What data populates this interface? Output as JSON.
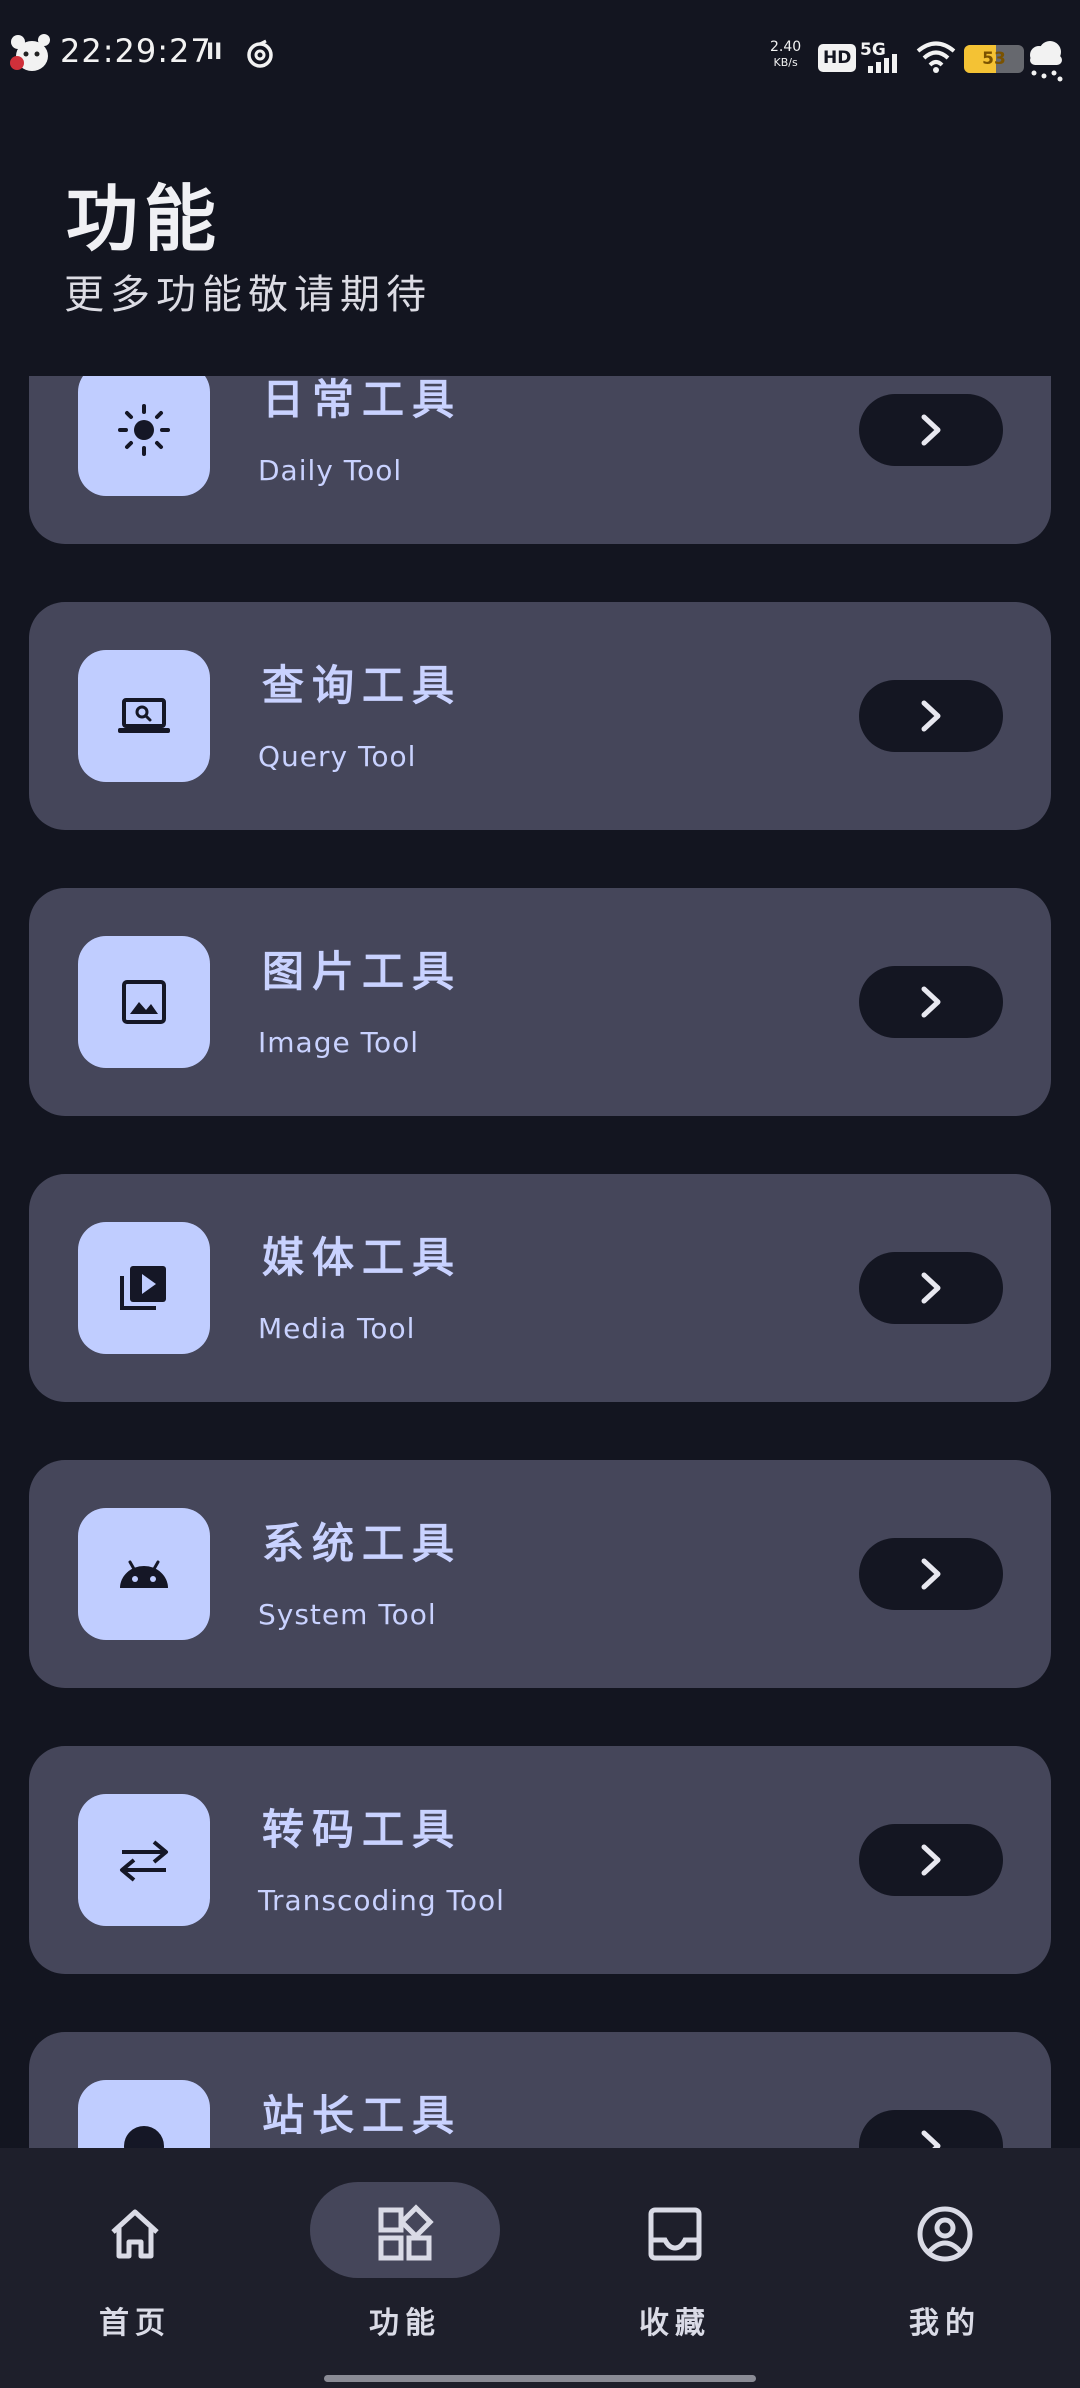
{
  "status_bar": {
    "time": "22:29:27",
    "pause": "II",
    "net_speed_value": "2.40",
    "net_speed_unit": "KB/s",
    "hd": "HD",
    "network": "5G",
    "battery": "53",
    "battery_level": 0.53
  },
  "header": {
    "title": "功能",
    "subtitle": "更多功能敬请期待"
  },
  "tools": [
    {
      "title": "日常工具",
      "subtitle": "Daily Tool",
      "icon": "sun-icon"
    },
    {
      "title": "查询工具",
      "subtitle": "Query Tool",
      "icon": "laptop-search-icon"
    },
    {
      "title": "图片工具",
      "subtitle": "Image Tool",
      "icon": "image-icon"
    },
    {
      "title": "媒体工具",
      "subtitle": "Media Tool",
      "icon": "video-library-icon"
    },
    {
      "title": "系统工具",
      "subtitle": "System Tool",
      "icon": "android-icon"
    },
    {
      "title": "转码工具",
      "subtitle": "Transcoding Tool",
      "icon": "swap-arrows-icon"
    },
    {
      "title": "站长工具",
      "subtitle": "",
      "icon": "globe-icon"
    }
  ],
  "nav": {
    "items": [
      {
        "label": "首页",
        "icon": "home-icon",
        "active": false
      },
      {
        "label": "功能",
        "icon": "apps-icon",
        "active": true
      },
      {
        "label": "收藏",
        "icon": "inbox-icon",
        "active": false
      },
      {
        "label": "我的",
        "icon": "account-icon",
        "active": false
      }
    ]
  },
  "colors": {
    "background": "#131520",
    "card": "#45465a",
    "icon_bg": "#c0cdff",
    "accent_text": "#c9d2ff",
    "nav_bg": "#1e1f2b"
  }
}
